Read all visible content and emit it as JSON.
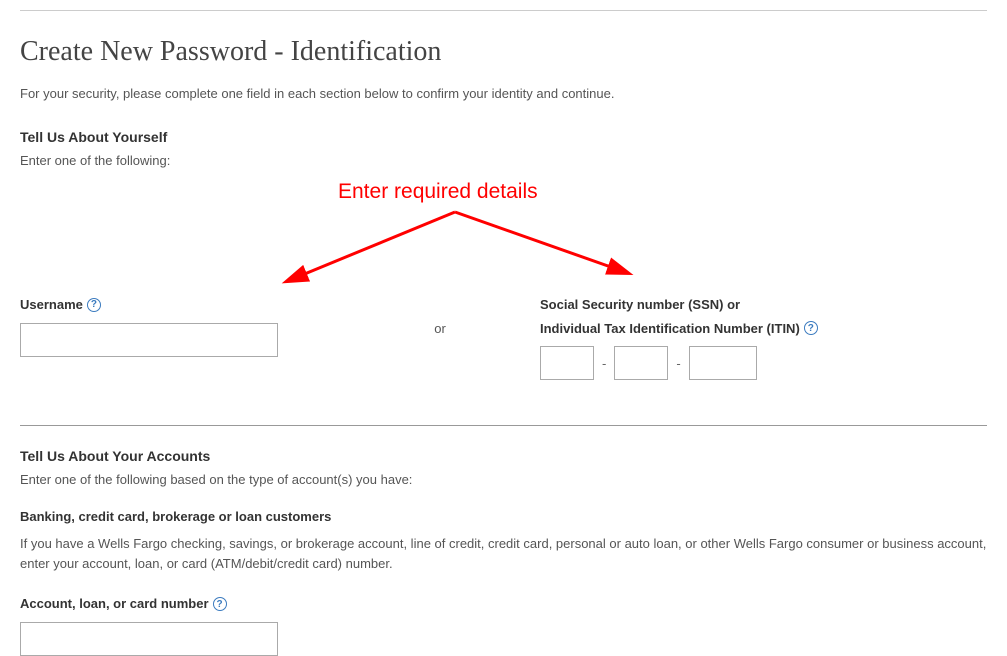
{
  "page": {
    "title": "Create New Password - Identification",
    "intro": "For your security, please complete one field in each section below to confirm your identity and continue."
  },
  "annotation": {
    "text": "Enter required details"
  },
  "section1": {
    "heading": "Tell Us About Yourself",
    "sub": "Enter one of the following:",
    "username_label": "Username",
    "or_text": "or",
    "ssn_label_line1": "Social Security number (SSN) or",
    "ssn_label_line2": "Individual Tax Identification Number (ITIN)",
    "help_glyph": "?",
    "dash": "-"
  },
  "section2": {
    "heading": "Tell Us About Your Accounts",
    "sub": "Enter one of the following based on the type of account(s) you have:",
    "customer_type": "Banking, credit card, brokerage or loan customers",
    "description": "If you have a Wells Fargo checking, savings, or brokerage account, line of credit, credit card, personal or auto loan, or other Wells Fargo consumer or business account, enter your account, loan, or card (ATM/debit/credit card) number.",
    "account_label": "Account, loan, or card number"
  }
}
